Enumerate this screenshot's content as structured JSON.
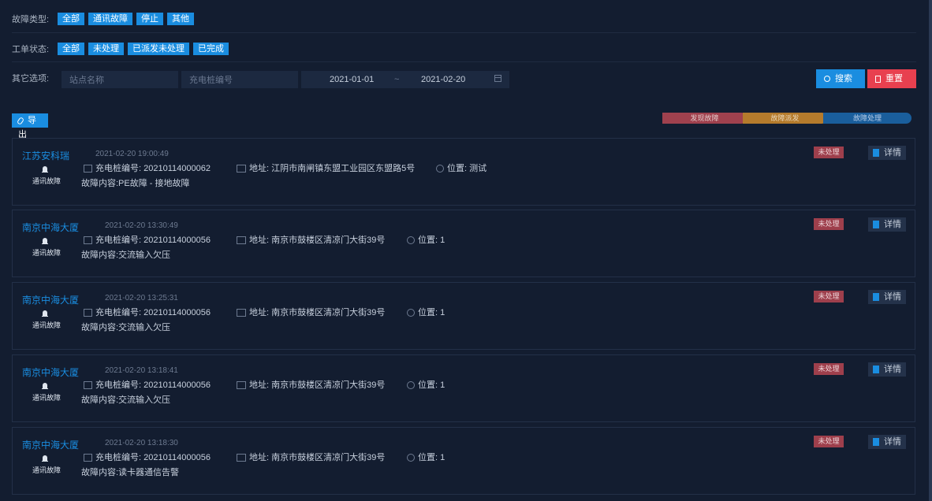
{
  "filters": {
    "fault_type": {
      "label": "故障类型:",
      "options": [
        "全部",
        "通讯故障",
        "停止",
        "其他"
      ]
    },
    "order_status": {
      "label": "工单状态:",
      "options": [
        "全部",
        "未处理",
        "已派发未处理",
        "已完成"
      ]
    },
    "other": {
      "label": "其它选项:",
      "site_placeholder": "站点名称",
      "pile_placeholder": "充电桩编号",
      "date_start": "2021-01-01",
      "date_sep": "~",
      "date_end": "2021-02-20"
    }
  },
  "buttons": {
    "search": "搜索",
    "reset": "重置",
    "export": "导出"
  },
  "progress": [
    "发现故障",
    "故障派发",
    "故障处理"
  ],
  "cards": [
    {
      "site": "江苏安科瑞",
      "time": "2021-02-20 19:00:49",
      "type": "通讯故障",
      "pile": "充电桩编号: 20210114000062",
      "addr": "地址: 江阴市南闸镇东盟工业园区东盟路5号",
      "loc": "位置: 测试",
      "content": "故障内容:PE故障 - 接地故障",
      "status": "未处理",
      "detail": "详情"
    },
    {
      "site": "南京中海大厦",
      "time": "2021-02-20 13:30:49",
      "type": "通讯故障",
      "pile": "充电桩编号: 20210114000056",
      "addr": "地址: 南京市鼓楼区清凉门大街39号",
      "loc": "位置: 1",
      "content": "故障内容:交流输入欠压",
      "status": "未处理",
      "detail": "详情"
    },
    {
      "site": "南京中海大厦",
      "time": "2021-02-20 13:25:31",
      "type": "通讯故障",
      "pile": "充电桩编号: 20210114000056",
      "addr": "地址: 南京市鼓楼区清凉门大街39号",
      "loc": "位置: 1",
      "content": "故障内容:交流输入欠压",
      "status": "未处理",
      "detail": "详情"
    },
    {
      "site": "南京中海大厦",
      "time": "2021-02-20 13:18:41",
      "type": "通讯故障",
      "pile": "充电桩编号: 20210114000056",
      "addr": "地址: 南京市鼓楼区清凉门大街39号",
      "loc": "位置: 1",
      "content": "故障内容:交流输入欠压",
      "status": "未处理",
      "detail": "详情"
    },
    {
      "site": "南京中海大厦",
      "time": "2021-02-20 13:18:30",
      "type": "通讯故障",
      "pile": "充电桩编号: 20210114000056",
      "addr": "地址: 南京市鼓楼区清凉门大街39号",
      "loc": "位置: 1",
      "content": "故障内容:读卡器通信告警",
      "status": "未处理",
      "detail": "详情"
    }
  ]
}
